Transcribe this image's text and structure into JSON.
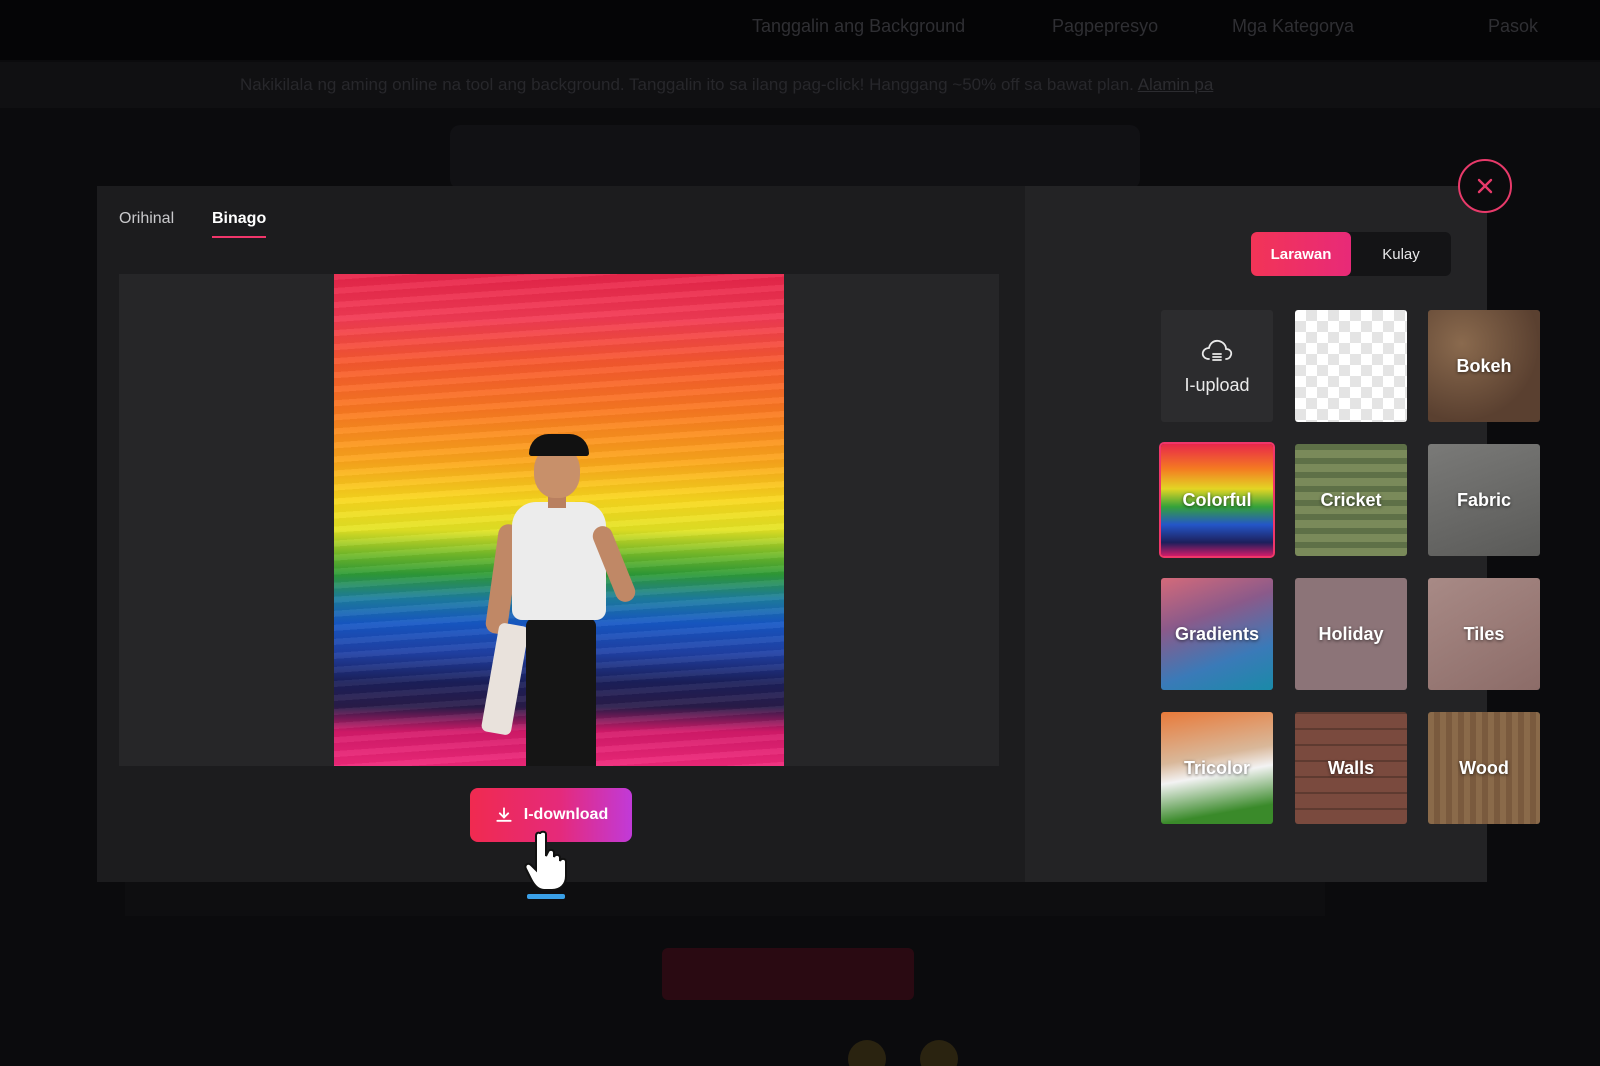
{
  "background_page": {
    "nav": [
      "Tanggalin ang Background",
      "Pagpepresyo",
      "Mga Kategorya",
      "Pasok"
    ],
    "banner_text": "Nakikilala ng aming online na tool ang background. Tanggalin ito sa ilang pag-click! Hanggang ~50% off sa bawat plan.",
    "banner_link": "Alamin pa"
  },
  "modal": {
    "tabs": [
      {
        "label": "Orihinal",
        "active": false
      },
      {
        "label": "Binago",
        "active": true
      }
    ],
    "download_label": "I-download",
    "segment": [
      {
        "label": "Larawan",
        "active": true
      },
      {
        "label": "Kulay",
        "active": false
      }
    ],
    "tiles": [
      {
        "label": "I-upload",
        "kind": "upload",
        "icon": "cloud-upload-icon"
      },
      {
        "label": "",
        "kind": "transparent"
      },
      {
        "label": "Bokeh",
        "kind": "bokeh"
      },
      {
        "label": "Colorful",
        "kind": "colorful",
        "selected": true
      },
      {
        "label": "Cricket",
        "kind": "cricket"
      },
      {
        "label": "Fabric",
        "kind": "fabric"
      },
      {
        "label": "Gradients",
        "kind": "gradients"
      },
      {
        "label": "Holiday",
        "kind": "holiday"
      },
      {
        "label": "Tiles",
        "kind": "tiles"
      },
      {
        "label": "Tricolor",
        "kind": "tricolor"
      },
      {
        "label": "Walls",
        "kind": "walls"
      },
      {
        "label": "Wood",
        "kind": "wood"
      }
    ],
    "close_icon": "close-icon"
  },
  "colors": {
    "accent": "#f0366a",
    "modal_bg": "#1c1c1e",
    "panel_bg": "#232325"
  }
}
